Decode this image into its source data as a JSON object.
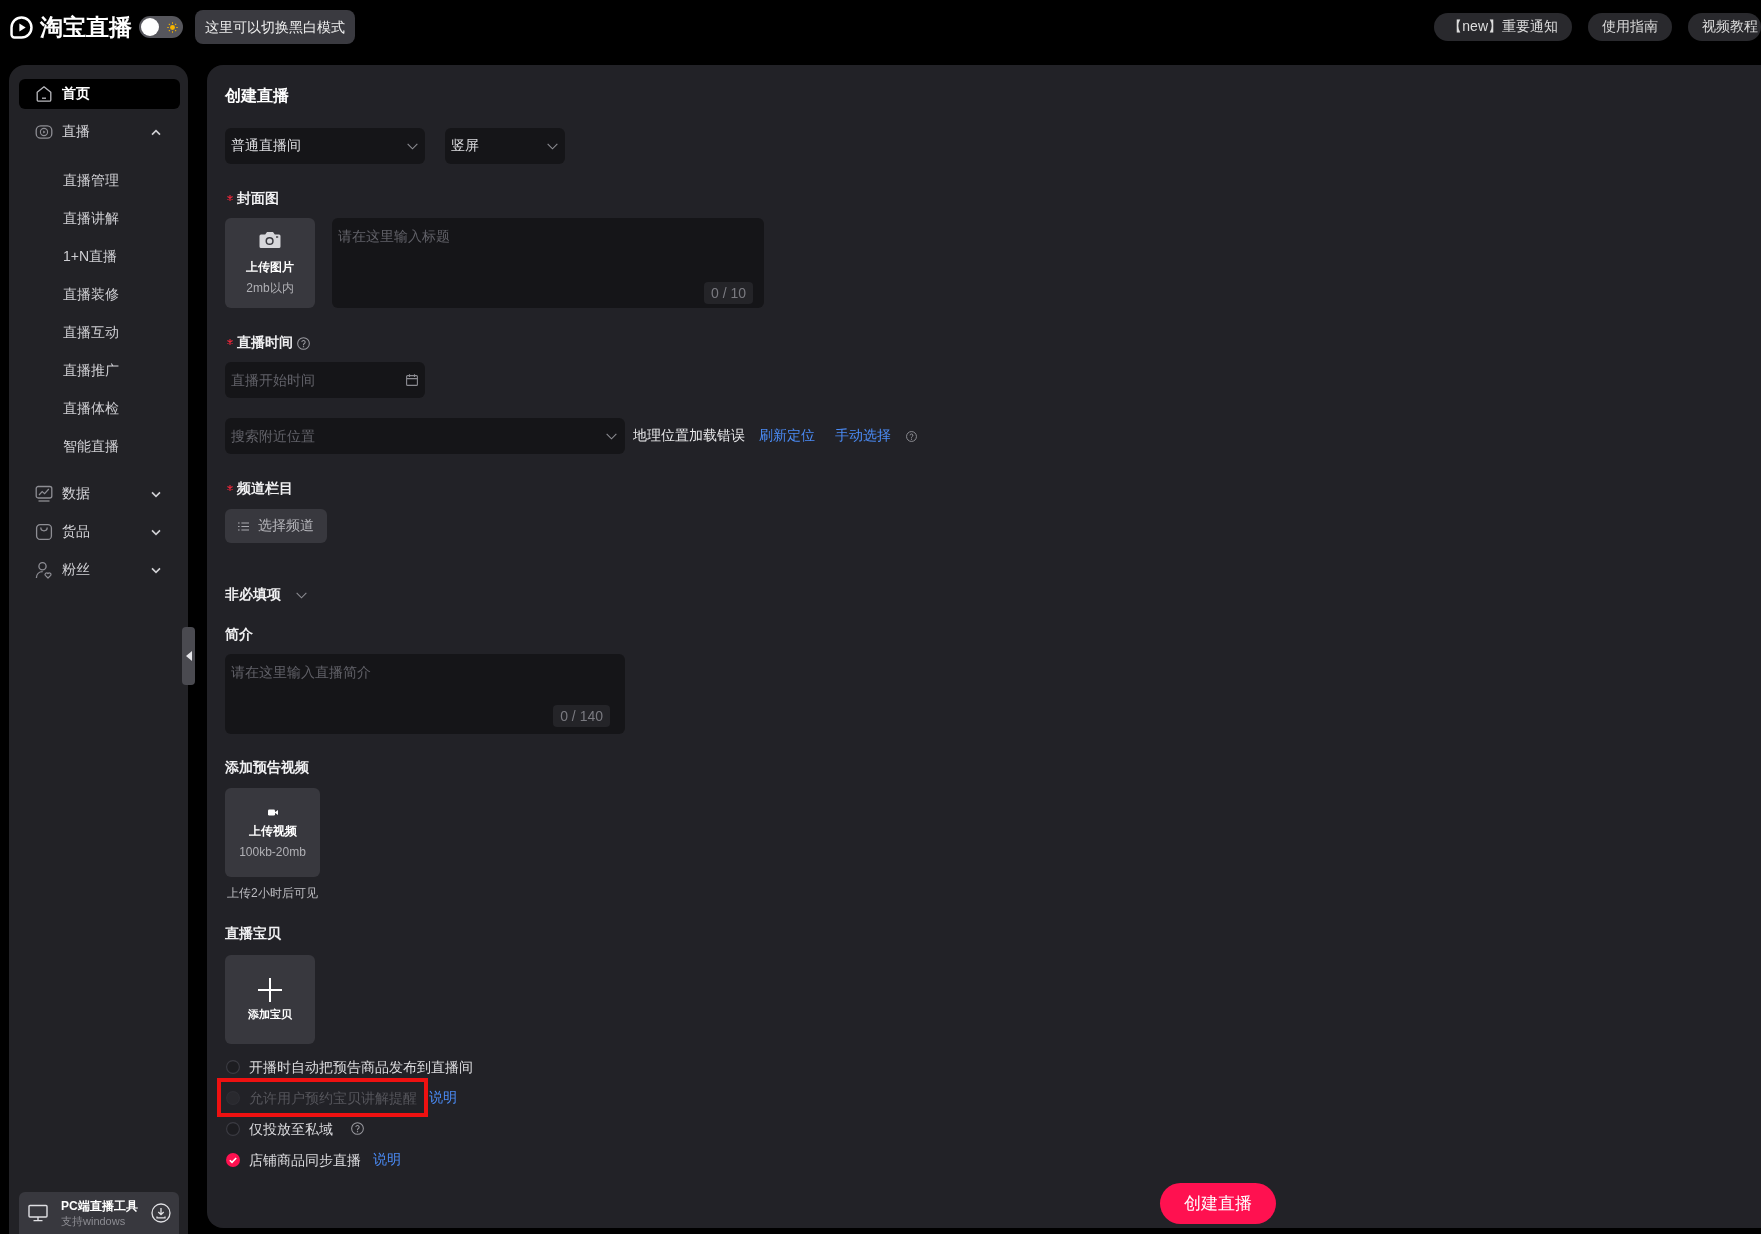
{
  "header": {
    "logo": "淘宝直播",
    "theme_toggle": {
      "on": false
    },
    "tooltip": "这里可以切换黑白模式",
    "links": [
      "【new】重要通知",
      "使用指南",
      "视频教程"
    ]
  },
  "sidebar": {
    "items": [
      {
        "label": "首页",
        "selected": true
      },
      {
        "label": "直播",
        "selected": false,
        "expanded": true,
        "children": [
          {
            "label": "直播管理",
            "selected": false
          },
          {
            "label": "直播讲解",
            "selected": false
          },
          {
            "label": "1+N直播",
            "selected": false
          },
          {
            "label": "直播装修",
            "selected": false
          },
          {
            "label": "直播互动",
            "selected": false
          },
          {
            "label": "直播推广",
            "selected": false
          },
          {
            "label": "直播体检",
            "selected": false
          },
          {
            "label": "智能直播",
            "selected": false
          }
        ]
      },
      {
        "label": "数据",
        "selected": false,
        "expanded": false
      },
      {
        "label": "货品",
        "selected": false,
        "expanded": false
      },
      {
        "label": "粉丝",
        "selected": false,
        "expanded": false
      }
    ],
    "pc_tool": {
      "title": "PC端直播工具",
      "subtitle": "支持windows"
    }
  },
  "form": {
    "title": "创建直播",
    "room_type": "普通直播间",
    "orientation": "竖屏",
    "cover": {
      "label": "封面图",
      "required": true,
      "upload_label": "上传图片",
      "upload_hint": "2mb以内"
    },
    "title_field": {
      "placeholder": "请在这里输入标题",
      "counter": "0 / 10"
    },
    "time": {
      "label": "直播时间",
      "required": true,
      "help": true,
      "placeholder": "直播开始时间"
    },
    "location": {
      "placeholder": "搜索附近位置",
      "error": "地理位置加载错误",
      "links": [
        "刷新定位",
        "手动选择"
      ],
      "help": true
    },
    "channel": {
      "label": "频道栏目",
      "required": true,
      "button": "选择频道"
    },
    "optional_section": {
      "label": "非必填项"
    },
    "intro": {
      "label": "简介",
      "placeholder": "请在这里输入直播简介",
      "counter": "0 / 140"
    },
    "preview_video": {
      "label": "添加预告视频",
      "upload_label": "上传视频",
      "upload_hint": "100kb-20mb",
      "note": "上传2小时后可见"
    },
    "products": {
      "label": "直播宝贝",
      "add_label": "添加宝贝"
    },
    "options": [
      {
        "label": "开播时自动把预告商品发布到直播间",
        "checked": false,
        "disabled": false
      },
      {
        "label": "允许用户预约宝贝讲解提醒",
        "checked": false,
        "disabled": true,
        "highlighted": true,
        "link": "说明"
      },
      {
        "label": "仅投放至私域",
        "checked": false,
        "disabled": false,
        "help": true
      },
      {
        "label": "店铺商品同步直播",
        "checked": true,
        "disabled": false,
        "link": "说明"
      }
    ],
    "submit": "创建直播"
  }
}
